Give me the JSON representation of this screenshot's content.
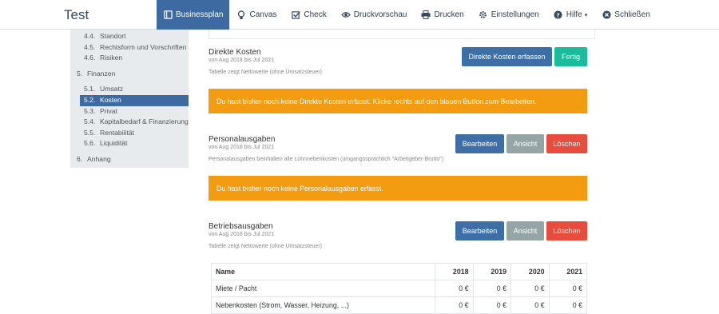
{
  "app": {
    "title": "Test"
  },
  "nav": [
    {
      "label": "Businessplan",
      "icon": "book-icon",
      "active": true
    },
    {
      "label": "Canvas",
      "icon": "lightbulb-icon"
    },
    {
      "label": "Check",
      "icon": "checkbox-icon"
    },
    {
      "label": "Druckvorschau",
      "icon": "eye-icon"
    },
    {
      "label": "Drucken",
      "icon": "printer-icon"
    },
    {
      "label": "Einstellungen",
      "icon": "gear-icon"
    },
    {
      "label": "Hilfe",
      "icon": "question-circle-icon",
      "caret": "▾"
    },
    {
      "label": "Schließen",
      "icon": "close-circle-icon"
    }
  ],
  "sidebar": {
    "items": [
      {
        "num": "4.4.",
        "label": "Standort"
      },
      {
        "num": "4.5.",
        "label": "Rechtsform und Vorschriften"
      },
      {
        "num": "4.6.",
        "label": "Risiken"
      },
      {
        "num": "5.",
        "label": "Finanzen"
      },
      {
        "num": "5.1.",
        "label": "Umsatz"
      },
      {
        "num": "5.2.",
        "label": "Kosten"
      },
      {
        "num": "5.3.",
        "label": "Privat"
      },
      {
        "num": "5.4.",
        "label": "Kapitalbedarf & Finanzierung"
      },
      {
        "num": "5.5.",
        "label": "Rentabilität"
      },
      {
        "num": "5.6.",
        "label": "Liquidität"
      },
      {
        "num": "6.",
        "label": "Anhang"
      }
    ]
  },
  "sections": {
    "direkte": {
      "title": "Direkte Kosten",
      "range": "von Aug 2018 bis Jul 2021",
      "note": "Tabelle zeigt Nettowerte (ohne Umsatzsteuer)",
      "btn_add": "Direkte Kosten erfassen",
      "btn_done": "Fertig",
      "alert": "Du hast bisher noch keine Direkte Kosten erfasst. Klicke rechts auf den blauen Button zum Bearbeiten."
    },
    "personal": {
      "title": "Personalausgaben",
      "range": "von Aug 2018 bis Jul 2021",
      "note": "Personalausgaben beinhalten alle Lohnnebenkosten (umgangssprachlich \"Arbeitgeber-Brutto\")",
      "btn_edit": "Bearbeiten",
      "btn_view": "Ansicht",
      "btn_delete": "Löschen",
      "alert": "Du hast bisher noch keine Personalausgaben erfasst."
    },
    "betrieb": {
      "title": "Betriebsausgaben",
      "range": "von Aug 2018 bis Jul 2021",
      "note": "Tabelle zeigt Nettowerte (ohne Umsatzsteuer)",
      "btn_edit": "Bearbeiten",
      "btn_view": "Ansicht",
      "btn_delete": "Löschen"
    }
  },
  "table": {
    "headers": [
      "Name",
      "2018",
      "2019",
      "2020",
      "2021"
    ],
    "rows": [
      [
        "Miete / Pacht",
        "0 €",
        "0 €",
        "0 €",
        "0 €"
      ],
      [
        "Nebenkosten (Strom, Wasser, Heizung, ...)",
        "0 €",
        "0 €",
        "0 €",
        "0 €"
      ]
    ]
  }
}
